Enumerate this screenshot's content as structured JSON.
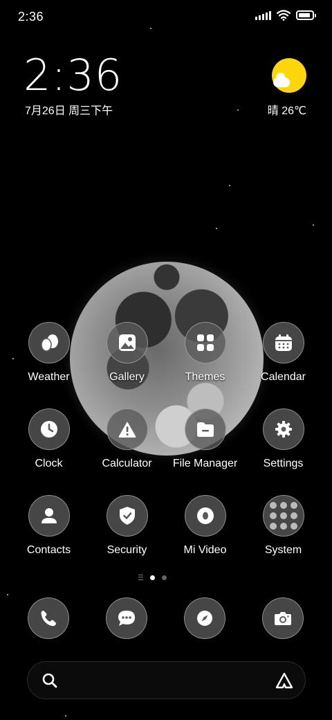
{
  "status_bar": {
    "time": "2:36"
  },
  "clock_widget": {
    "time": "2:36",
    "date": "7月26日 周三下午"
  },
  "weather_widget": {
    "text": "晴 26℃",
    "sun_color": "#ffd60a"
  },
  "wallpaper": {
    "subject": "moon"
  },
  "apps": [
    {
      "label": "Weather",
      "icon": "weather-icon"
    },
    {
      "label": "Gallery",
      "icon": "gallery-icon"
    },
    {
      "label": "Themes",
      "icon": "themes-icon"
    },
    {
      "label": "Calendar",
      "icon": "calendar-icon"
    },
    {
      "label": "Clock",
      "icon": "clock-icon"
    },
    {
      "label": "Calculator",
      "icon": "calculator-icon"
    },
    {
      "label": "File Manager",
      "icon": "file-manager-icon"
    },
    {
      "label": "Settings",
      "icon": "settings-icon"
    },
    {
      "label": "Contacts",
      "icon": "contacts-icon"
    },
    {
      "label": "Security",
      "icon": "security-icon"
    },
    {
      "label": "Mi Video",
      "icon": "mi-video-icon"
    },
    {
      "label": "System",
      "icon": "system-folder-icon"
    }
  ],
  "pager": {
    "pages": 2,
    "active_page": 1
  },
  "dock": [
    {
      "icon": "phone-icon"
    },
    {
      "icon": "messages-icon"
    },
    {
      "icon": "browser-icon"
    },
    {
      "icon": "camera-icon"
    }
  ],
  "search_bar": {
    "left_icon": "search-icon",
    "right_icon": "assistant-icon"
  },
  "colors": {
    "background": "#000000",
    "icon_bg": "#5a5a5a",
    "text": "#ffffff"
  }
}
